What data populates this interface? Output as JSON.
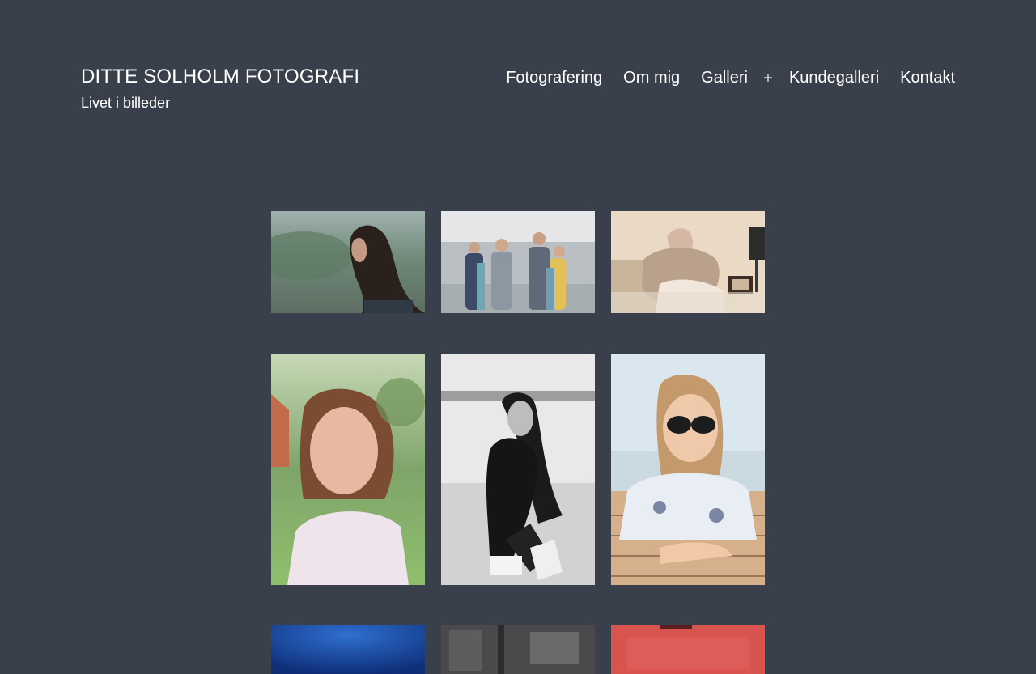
{
  "site": {
    "title": "DITTE SOLHOLM FOTOGRAFI",
    "tagline": "Livet i billeder"
  },
  "nav": {
    "items": [
      {
        "label": "Fotografering"
      },
      {
        "label": "Om mig"
      },
      {
        "label": "Galleri"
      },
      {
        "label": "Kundegalleri"
      },
      {
        "label": "Kontakt"
      }
    ],
    "submenu_toggle_icon": "plus-icon"
  },
  "colors": {
    "background": "#39404b",
    "text": "#ffffff"
  },
  "gallery": {
    "images": [
      {
        "subject": "man-with-long-hair-profile-photo"
      },
      {
        "subject": "family-on-beach-photo"
      },
      {
        "subject": "grandfather-hugging-child-photo"
      },
      {
        "subject": "girl-in-garden-portrait-photo"
      },
      {
        "subject": "girl-sitting-on-beach-bw-photo"
      },
      {
        "subject": "girl-with-sunglasses-on-pier-photo"
      },
      {
        "subject": "blue-image-photo"
      },
      {
        "subject": "dark-building-photo"
      },
      {
        "subject": "red-image-photo"
      }
    ]
  }
}
